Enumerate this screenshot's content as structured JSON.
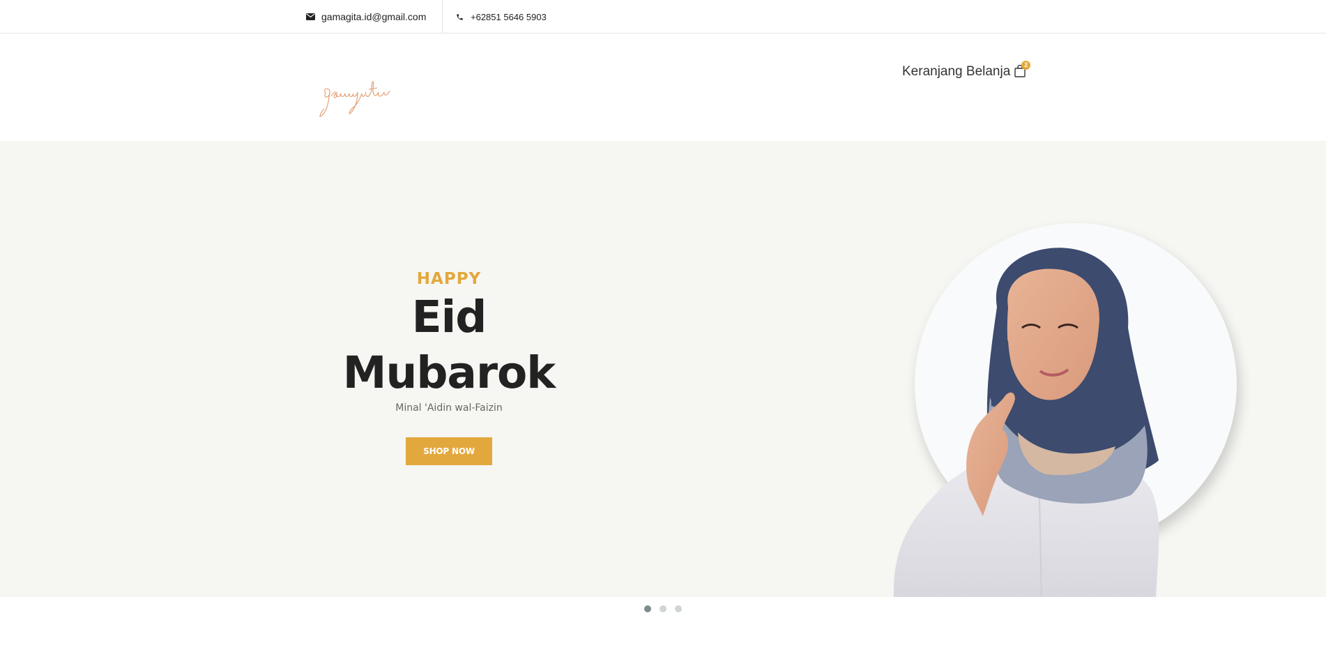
{
  "topbar": {
    "email": "gamagita.id@gmail.com",
    "phone": "+62851 5646 5903"
  },
  "header": {
    "logo_text": "gamagita",
    "cart_label": "Keranjang Belanja",
    "cart_count": "2"
  },
  "hero": {
    "kicker": "HAPPY",
    "title": "Eid Mubarok",
    "subtitle": "Minal 'Aidin wal-Faizin",
    "cta_label": "SHOP NOW"
  },
  "slider": {
    "total_slides": 3,
    "active_index": 0
  },
  "colors": {
    "accent": "#e3a83d",
    "hero_bg": "#f6f6f2",
    "logo": "#e39a6c"
  },
  "icons": [
    "envelope-icon",
    "phone-icon",
    "shopping-bag-icon"
  ]
}
